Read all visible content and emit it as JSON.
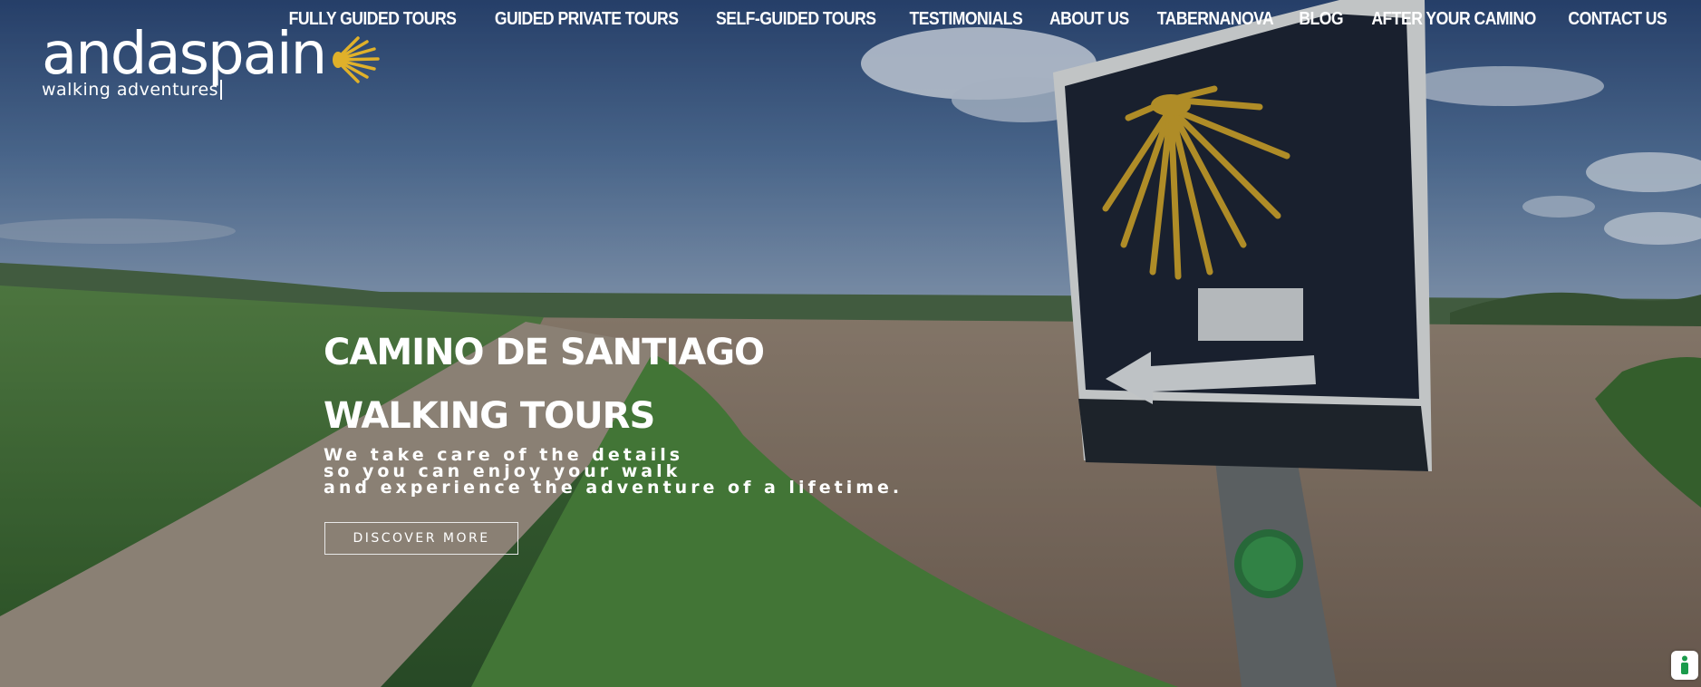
{
  "brand": {
    "name": "andaspain",
    "tagline": "walking adventures",
    "shell_color": "#e0b12a"
  },
  "nav": {
    "items": [
      {
        "label": "FULLY GUIDED TOURS"
      },
      {
        "label": "GUIDED PRIVATE TOURS"
      },
      {
        "label": "SELF-GUIDED TOURS"
      },
      {
        "label": "TESTIMONIALS"
      },
      {
        "label": "ABOUT US"
      },
      {
        "label": "TABERNANOVA"
      },
      {
        "label": "BLOG"
      },
      {
        "label": "AFTER YOUR CAMINO"
      },
      {
        "label": "CONTACT US"
      }
    ]
  },
  "hero": {
    "title_line1": "CAMINO DE SANTIAGO",
    "title_line2": "WALKING TOURS",
    "tagline_line1": "We take care of the details",
    "tagline_line2": "so you can enjoy your walk",
    "tagline_line3": "and experience the adventure of a lifetime.",
    "cta_label": "DISCOVER MORE"
  },
  "badge": {
    "icon": "accessibility-icon",
    "color": "#1a9b4b"
  }
}
